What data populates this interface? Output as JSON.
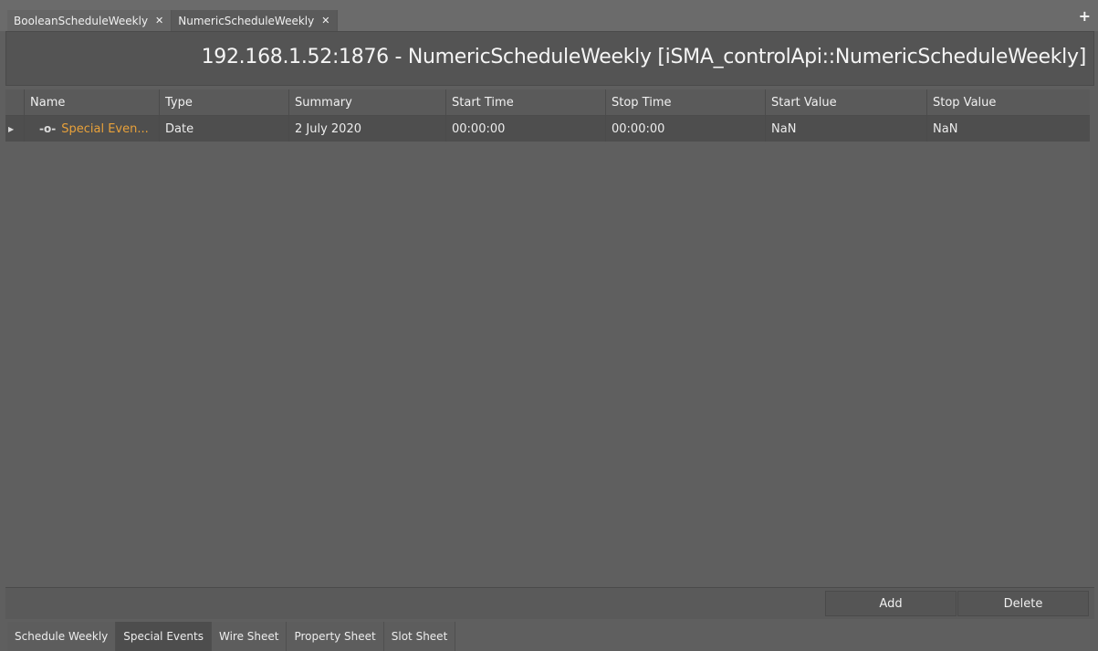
{
  "tabs": [
    {
      "label": "BooleanScheduleWeekly",
      "active": false
    },
    {
      "label": "NumericScheduleWeekly",
      "active": true
    }
  ],
  "title": "192.168.1.52:1876 - NumericScheduleWeekly [iSMA_controlApi::NumericScheduleWeekly]",
  "table": {
    "headers": [
      "Name",
      "Type",
      "Summary",
      "Start Time",
      "Stop Time",
      "Start Value",
      "Stop Value"
    ],
    "rows": [
      {
        "name": "Special Even...",
        "type": "Date",
        "summary": "2 July 2020",
        "start_time": "00:00:00",
        "stop_time": "00:00:00",
        "start_value": "NaN",
        "stop_value": "NaN"
      }
    ]
  },
  "buttons": {
    "add": "Add",
    "delete": "Delete"
  },
  "view_tabs": [
    {
      "label": "Schedule Weekly",
      "active": false
    },
    {
      "label": "Special Events",
      "active": true
    },
    {
      "label": "Wire Sheet",
      "active": false
    },
    {
      "label": "Property Sheet",
      "active": false
    },
    {
      "label": "Slot Sheet",
      "active": false
    }
  ],
  "icons": {
    "close": "close-icon",
    "plus": "plus-icon",
    "expander": "expander-icon",
    "slot": "slot-icon"
  },
  "colors": {
    "name_highlight": "#e8a13a",
    "background": "#5f5f5f"
  }
}
